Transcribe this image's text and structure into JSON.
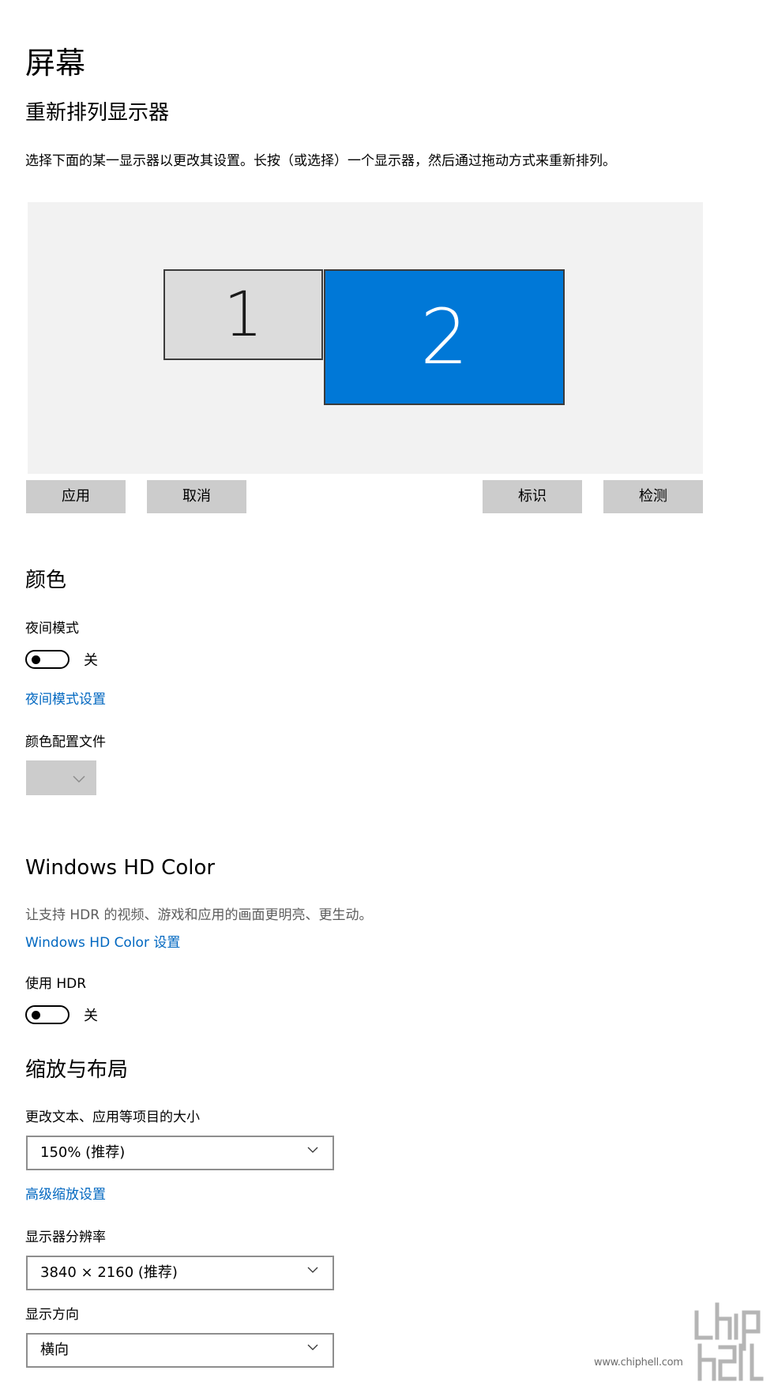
{
  "page": {
    "title": "屏幕"
  },
  "arrange": {
    "heading": "重新排列显示器",
    "description": "选择下面的某一显示器以更改其设置。长按（或选择）一个显示器，然后通过拖动方式来重新排列。",
    "monitors": [
      "1",
      "2"
    ],
    "apply_label": "应用",
    "cancel_label": "取消",
    "identify_label": "标识",
    "detect_label": "检测"
  },
  "color": {
    "heading": "颜色",
    "night_light_label": "夜间模式",
    "night_light_state": "关",
    "night_light_settings_link": "夜间模式设置",
    "profile_label": "颜色配置文件"
  },
  "hdr": {
    "heading": "Windows HD Color",
    "description": "让支持 HDR 的视频、游戏和应用的画面更明亮、更生动。",
    "settings_link": "Windows HD Color 设置",
    "use_hdr_label": "使用 HDR",
    "use_hdr_state": "关"
  },
  "scale": {
    "heading": "缩放与布局",
    "size_label": "更改文本、应用等项目的大小",
    "size_value": "150% (推荐)",
    "advanced_link": "高级缩放设置",
    "resolution_label": "显示器分辨率",
    "resolution_value": "3840 × 2160 (推荐)",
    "orientation_label": "显示方向",
    "orientation_value": "横向"
  },
  "watermark": {
    "text": "www.chiphell.com",
    "logo": "chip hell"
  },
  "colors": {
    "accent": "#0078d7",
    "link": "#0067c0",
    "button_bg": "#cccccc",
    "arrange_bg": "#f2f2f2"
  }
}
